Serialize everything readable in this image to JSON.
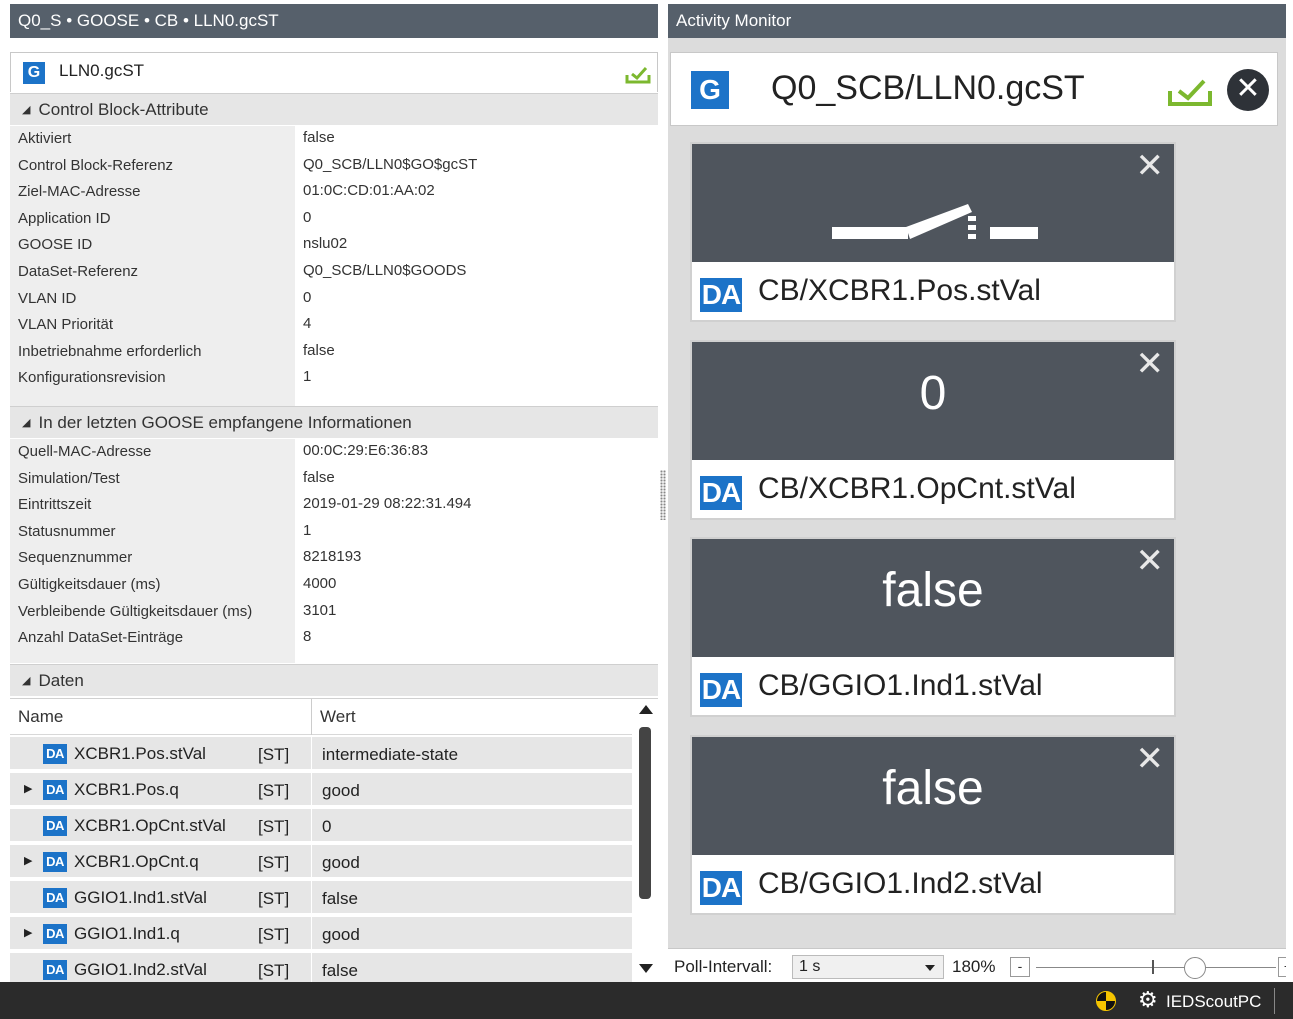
{
  "left_panel": {
    "title": "Q0_S • GOOSE • CB • LLN0.gcST",
    "header": {
      "badge": "G",
      "text": "LLN0.gcST"
    },
    "groups": [
      {
        "title": "Control Block-Attribute",
        "rows": [
          {
            "key": "Aktiviert",
            "value": "false"
          },
          {
            "key": "Control Block-Referenz",
            "value": "Q0_SCB/LLN0$GO$gcST"
          },
          {
            "key": "Ziel-MAC-Adresse",
            "value": "01:0C:CD:01:AA:02"
          },
          {
            "key": "Application ID",
            "value": "0"
          },
          {
            "key": "GOOSE ID",
            "value": "nslu02"
          },
          {
            "key": "DataSet-Referenz",
            "value": "Q0_SCB/LLN0$GOODS"
          },
          {
            "key": "VLAN ID",
            "value": "0"
          },
          {
            "key": "VLAN Priorität",
            "value": "4"
          },
          {
            "key": "Inbetriebnahme erforderlich",
            "value": "false"
          },
          {
            "key": "Konfigurationsrevision",
            "value": "1"
          }
        ]
      },
      {
        "title": "In der letzten GOOSE empfangene Informationen",
        "rows": [
          {
            "key": "Quell-MAC-Adresse",
            "value": "00:0C:29:E6:36:83"
          },
          {
            "key": "Simulation/Test",
            "value": "false"
          },
          {
            "key": "Eintrittszeit",
            "value": "2019-01-29 08:22:31.494"
          },
          {
            "key": "Statusnummer",
            "value": "1"
          },
          {
            "key": "Sequenznummer",
            "value": "8218193"
          },
          {
            "key": "Gültigkeitsdauer (ms)",
            "value": "4000"
          },
          {
            "key": "Verbleibende Gültigkeitsdauer (ms)",
            "value": "3101"
          },
          {
            "key": "Anzahl DataSet-Einträge",
            "value": "8"
          }
        ]
      },
      {
        "title": "Daten"
      }
    ],
    "grid": {
      "col_name": "Name",
      "col_value": "Wert",
      "rows": [
        {
          "expandable": false,
          "badge": "DA",
          "name": "XCBR1.Pos.stVal",
          "type": "[ST]",
          "value": "intermediate-state"
        },
        {
          "expandable": true,
          "badge": "DA",
          "name": "XCBR1.Pos.q",
          "type": "[ST]",
          "value": "good"
        },
        {
          "expandable": false,
          "badge": "DA",
          "name": "XCBR1.OpCnt.stVal",
          "type": "[ST]",
          "value": "0"
        },
        {
          "expandable": true,
          "badge": "DA",
          "name": "XCBR1.OpCnt.q",
          "type": "[ST]",
          "value": "good"
        },
        {
          "expandable": false,
          "badge": "DA",
          "name": "GGIO1.Ind1.stVal",
          "type": "[ST]",
          "value": "false"
        },
        {
          "expandable": true,
          "badge": "DA",
          "name": "GGIO1.Ind1.q",
          "type": "[ST]",
          "value": "good"
        },
        {
          "expandable": false,
          "badge": "DA",
          "name": "GGIO1.Ind2.stVal",
          "type": "[ST]",
          "value": "false"
        }
      ]
    }
  },
  "activity_monitor": {
    "title": "Activity Monitor",
    "header": {
      "badge": "G",
      "text": "Q0_SCB/LLN0.gcST"
    },
    "tiles": [
      {
        "value": "",
        "icon": "switch-open-icon",
        "badge": "DA",
        "label": "CB/XCBR1.Pos.stVal"
      },
      {
        "value": "0",
        "badge": "DA",
        "label": "CB/XCBR1.OpCnt.stVal"
      },
      {
        "value": "false",
        "badge": "DA",
        "label": "CB/GGIO1.Ind1.stVal"
      },
      {
        "value": "false",
        "badge": "DA",
        "label": "CB/GGIO1.Ind2.stVal"
      }
    ],
    "footer": {
      "poll_label": "Poll-Intervall:",
      "poll_value": "1 s",
      "zoom": "180%"
    }
  },
  "statusbar": {
    "pc_name": "IEDScoutPC"
  },
  "colors": {
    "accent": "#1c73c8",
    "title_bar": "#56606b",
    "tile_bg": "#4f555d",
    "check": "#7cb82f"
  }
}
